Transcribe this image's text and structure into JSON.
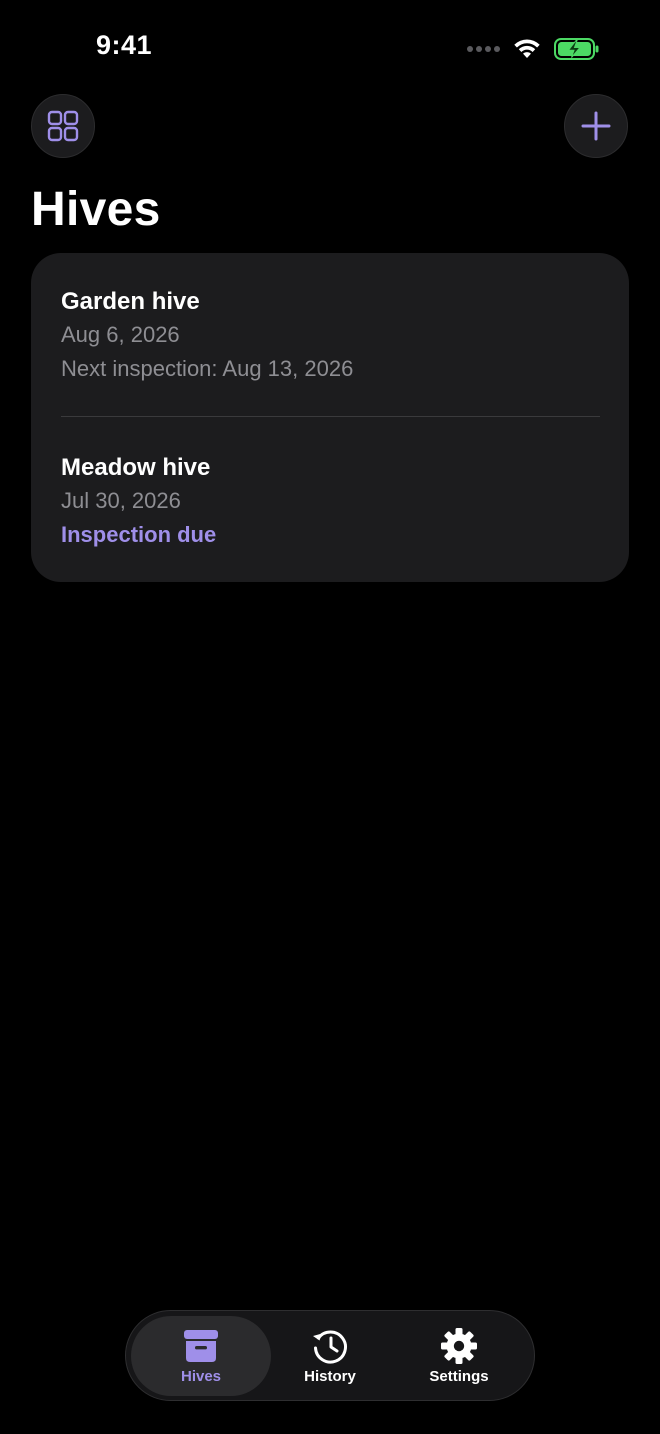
{
  "status_bar": {
    "time": "9:41"
  },
  "header": {
    "title": "Hives",
    "left_button_icon": "grid-icon",
    "right_button_icon": "plus-icon"
  },
  "hives": [
    {
      "name": "Garden hive",
      "date": "Aug 6, 2026",
      "detail": "Next inspection: Aug 13, 2026",
      "detail_style": "secondary"
    },
    {
      "name": "Meadow hive",
      "date": "Jul 30, 2026",
      "detail": "Inspection due",
      "detail_style": "accent"
    }
  ],
  "tabbar": {
    "tabs": [
      {
        "label": "Hives",
        "icon": "archive-box-icon",
        "active": true
      },
      {
        "label": "History",
        "icon": "history-clock-icon",
        "active": false
      },
      {
        "label": "Settings",
        "icon": "gear-icon",
        "active": false
      }
    ]
  },
  "colors": {
    "accent": "#9f8fe9",
    "background": "#000000",
    "card": "#1c1c1e",
    "secondary_text": "#8e8e93",
    "battery": "#4cd964"
  }
}
